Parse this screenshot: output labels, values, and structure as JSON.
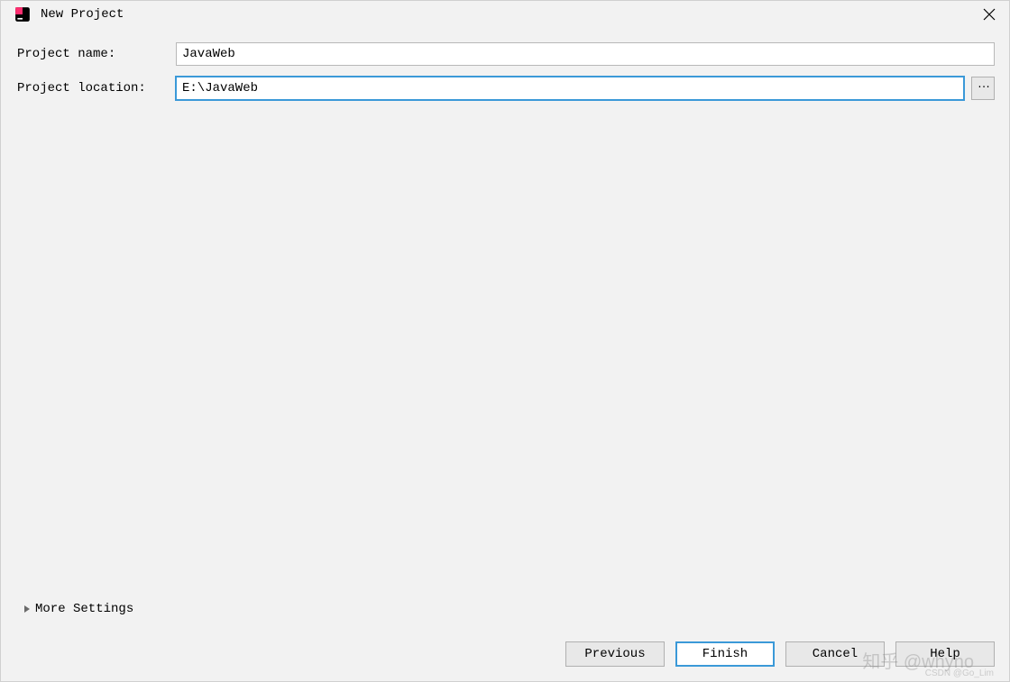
{
  "window": {
    "title": "New Project",
    "icon": "intellij-icon"
  },
  "form": {
    "project_name_label": "Project name:",
    "project_name_value": "JavaWeb",
    "project_location_label": "Project location:",
    "project_location_value": "E:\\JavaWeb",
    "browse_label": "..."
  },
  "more_settings_label": "More Settings",
  "buttons": {
    "previous": "Previous",
    "finish": "Finish",
    "cancel": "Cancel",
    "help": "Help"
  },
  "watermark1": "知乎 @whyno",
  "watermark2": "CSDN @Go_Lim"
}
